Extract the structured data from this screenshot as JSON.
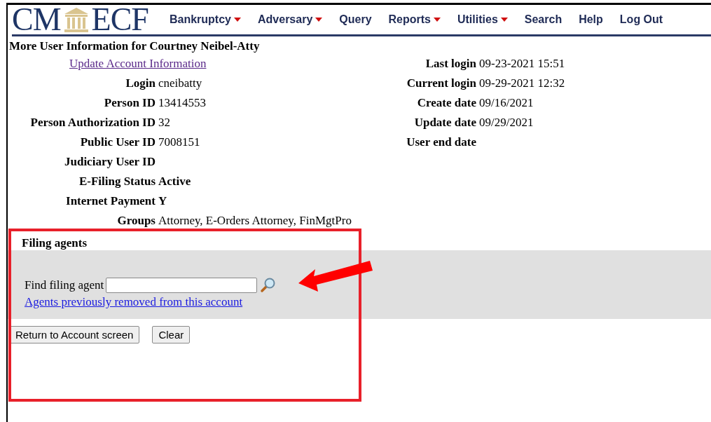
{
  "logo": {
    "left": "CM",
    "right": "ECF"
  },
  "menu": [
    {
      "label": "Bankruptcy",
      "has_menu": true
    },
    {
      "label": "Adversary",
      "has_menu": true
    },
    {
      "label": "Query",
      "has_menu": false
    },
    {
      "label": "Reports",
      "has_menu": true
    },
    {
      "label": "Utilities",
      "has_menu": true
    },
    {
      "label": "Search",
      "has_menu": false
    },
    {
      "label": "Help",
      "has_menu": false
    },
    {
      "label": "Log Out",
      "has_menu": false
    }
  ],
  "title": "More User Information for Courtney Neibel-Atty",
  "update_link": "Update Account Information",
  "left_fields": [
    {
      "label": "Login",
      "value": "cneibatty"
    },
    {
      "label": "Person ID",
      "value": "13414553"
    },
    {
      "label": "Person Authorization ID",
      "value": "32"
    },
    {
      "label": "Public User ID",
      "value": "7008151"
    },
    {
      "label": "Judiciary User ID"
    },
    {
      "label": "E-Filing Status",
      "value": "Active",
      "bold": true
    },
    {
      "label": "Internet Payment",
      "value": "Y",
      "bold": true
    },
    {
      "label": "Groups",
      "value": "Attorney, E-Orders Attorney, FinMgtPro"
    }
  ],
  "right_fields": [
    {
      "label": "Last login",
      "value": "09-23-2021 15:51"
    },
    {
      "label": "Current login",
      "value": "09-29-2021 12:32"
    },
    {
      "label": "Create date",
      "value": "09/16/2021"
    },
    {
      "label": "Update date",
      "value": "09/29/2021"
    },
    {
      "label": "User end date"
    }
  ],
  "filing_agents": {
    "heading": "Filing agents",
    "find_label": "Find filing agent",
    "removed_link": "Agents previously removed from this account"
  },
  "buttons": [
    "Return to Account screen",
    "Clear"
  ]
}
